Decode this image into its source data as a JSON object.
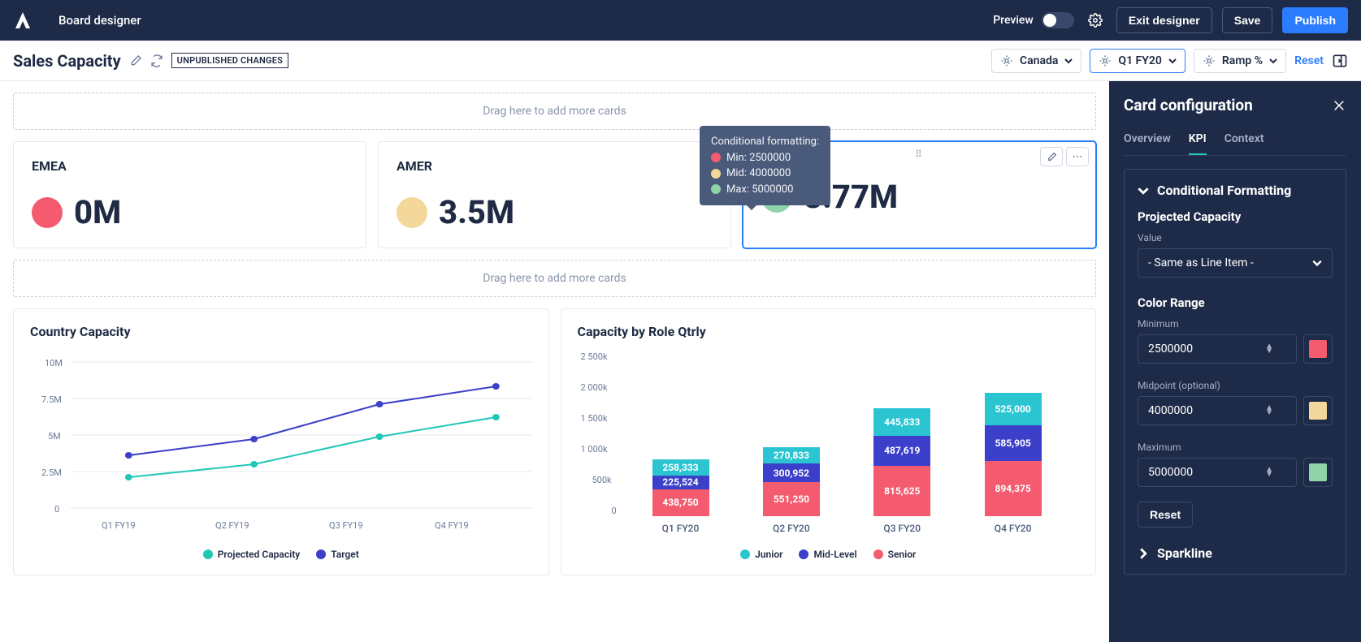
{
  "header": {
    "app_title": "Board designer",
    "preview_label": "Preview",
    "exit_label": "Exit designer",
    "save_label": "Save",
    "publish_label": "Publish"
  },
  "subheader": {
    "page_title": "Sales Capacity",
    "badge": "UNPUBLISHED CHANGES",
    "filter1": "Canada",
    "filter2": "Q1 FY20",
    "filter3": "Ramp %",
    "reset": "Reset"
  },
  "dropzone": "Drag here to add more cards",
  "kpis": [
    {
      "region": "EMEA",
      "value": "0M",
      "color": "#f45b6f"
    },
    {
      "region": "AMER",
      "value": "3.5M",
      "color": "#f4d79a"
    },
    {
      "region": "",
      "value": "8.77M",
      "color": "#8fd4a8"
    }
  ],
  "tooltip": {
    "title": "Conditional formatting:",
    "rows": [
      {
        "label": "Min: 2500000",
        "color": "#f45b6f"
      },
      {
        "label": "Mid: 4000000",
        "color": "#f4d79a"
      },
      {
        "label": "Max: 5000000",
        "color": "#8fd4a8"
      }
    ]
  },
  "chart_data": [
    {
      "type": "line",
      "title": "Country Capacity",
      "categories": [
        "Q1 FY19",
        "Q2 FY19",
        "Q3 FY19",
        "Q4 FY19"
      ],
      "yticks": [
        "0",
        "2.5M",
        "5M",
        "7.5M",
        "10M"
      ],
      "ylim": [
        0,
        10000000
      ],
      "series": [
        {
          "name": "Projected Capacity",
          "color": "#21c7b7",
          "values": [
            2100000,
            3000000,
            4900000,
            6200000
          ]
        },
        {
          "name": "Target",
          "color": "#3b3fca",
          "values": [
            3600000,
            4700000,
            7100000,
            8300000
          ]
        }
      ]
    },
    {
      "type": "bar",
      "title": "Capacity by Role Qtrly",
      "categories": [
        "Q1 FY20",
        "Q2 FY20",
        "Q3 FY20",
        "Q4 FY20"
      ],
      "yticks": [
        "0",
        "500k",
        "1 000k",
        "1 500k",
        "2 000k",
        "2 500k"
      ],
      "ylim": [
        0,
        2500000
      ],
      "series": [
        {
          "name": "Senior",
          "color": "#f45b6f",
          "values": [
            438750,
            551250,
            815625,
            894375
          ],
          "labels": [
            "438,750",
            "551,250",
            "815,625",
            "894,375"
          ]
        },
        {
          "name": "Mid-Level",
          "color": "#3b3fca",
          "values": [
            225524,
            300952,
            487619,
            585905
          ],
          "labels": [
            "225,524",
            "300,952",
            "487,619",
            "585,905"
          ]
        },
        {
          "name": "Junior",
          "color": "#2bc5d2",
          "values": [
            258333,
            270833,
            445833,
            525000
          ],
          "labels": [
            "258,333",
            "270,833",
            "445,833",
            "525,000"
          ]
        }
      ]
    }
  ],
  "sidepanel": {
    "title": "Card configuration",
    "tabs": [
      "Overview",
      "KPI",
      "Context"
    ],
    "section_title": "Conditional Formatting",
    "proj_label": "Projected Capacity",
    "value_label": "Value",
    "value_select": "- Same as Line Item -",
    "color_range": "Color Range",
    "min_label": "Minimum",
    "min_val": "2500000",
    "min_color": "#f45b6f",
    "mid_label": "Midpoint (optional)",
    "mid_val": "4000000",
    "mid_color": "#f4d79a",
    "max_label": "Maximum",
    "max_val": "5000000",
    "max_color": "#8fd4a8",
    "reset": "Reset",
    "sparkline": "Sparkline"
  }
}
